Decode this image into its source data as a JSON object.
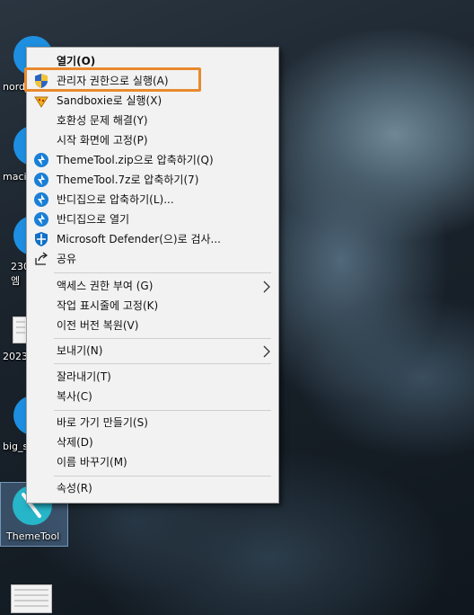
{
  "desktop": {
    "icons": [
      {
        "label": "nord_"
      },
      {
        "label": "maci"
      },
      {
        "label": "230"
      },
      {
        "label": "엠"
      },
      {
        "label": "2023"
      },
      {
        "label": "big_s"
      },
      {
        "label": "ThemeTool"
      }
    ]
  },
  "context_menu": {
    "items": [
      {
        "label": "열기(O)",
        "icon": "none"
      },
      {
        "label": "관리자 권한으로 실행(A)",
        "icon": "shield-icon"
      },
      {
        "label": "Sandboxie로 실행(X)",
        "icon": "sandboxie-icon"
      },
      {
        "label": "호환성 문제 해결(Y)",
        "icon": "none"
      },
      {
        "label": "시작 화면에 고정(P)",
        "icon": "none"
      },
      {
        "label": "ThemeTool.zip으로 압축하기(Q)",
        "icon": "bandizip-icon"
      },
      {
        "label": "ThemeTool.7z로 압축하기(7)",
        "icon": "bandizip-icon"
      },
      {
        "label": "반디집으로 압축하기(L)...",
        "icon": "bandizip-icon"
      },
      {
        "label": "반디집으로 열기",
        "icon": "bandizip-icon"
      },
      {
        "label": "Microsoft Defender(으)로 검사...",
        "icon": "defender-icon"
      },
      {
        "label": "공유",
        "icon": "share-icon"
      },
      {
        "label": "액세스 권한 부여 (G)",
        "icon": "none",
        "submenu": true
      },
      {
        "label": "작업 표시줄에 고정(K)",
        "icon": "none"
      },
      {
        "label": "이전 버전 복원(V)",
        "icon": "none"
      },
      {
        "label": "보내기(N)",
        "icon": "none",
        "submenu": true
      },
      {
        "label": "잘라내기(T)",
        "icon": "none"
      },
      {
        "label": "복사(C)",
        "icon": "none"
      },
      {
        "label": "바로 가기 만들기(S)",
        "icon": "none"
      },
      {
        "label": "삭제(D)",
        "icon": "none"
      },
      {
        "label": "이름 바꾸기(M)",
        "icon": "none"
      },
      {
        "label": "속성(R)",
        "icon": "none"
      }
    ]
  },
  "colors": {
    "highlight_border": "#e8892e",
    "menu_background": "#f2f2f2",
    "bandizip_blue": "#1a7fd6"
  }
}
